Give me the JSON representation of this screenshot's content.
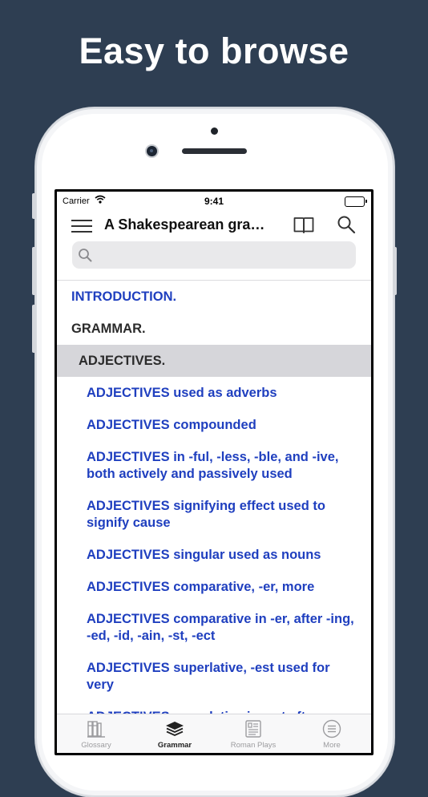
{
  "promo": {
    "headline": "Easy to browse"
  },
  "status_bar": {
    "carrier": "Carrier",
    "time": "9:41"
  },
  "navbar": {
    "title": "A Shakespearean gra…",
    "menu_icon": "hamburger-menu-icon",
    "book_icon": "open-book-icon",
    "search_icon": "search-icon"
  },
  "search": {
    "value": "",
    "placeholder": ""
  },
  "list": {
    "items": [
      {
        "label": "INTRODUCTION.",
        "level": "top-link"
      },
      {
        "label": "GRAMMAR.",
        "level": "top"
      },
      {
        "label": "ADJECTIVES.",
        "level": "selected"
      },
      {
        "label": "ADJECTIVES used as adverbs",
        "level": "sub"
      },
      {
        "label": "ADJECTIVES compounded",
        "level": "sub"
      },
      {
        "label": "ADJECTIVES in -ful, -less, -ble, and -ive, both actively and passively used",
        "level": "sub"
      },
      {
        "label": "ADJECTIVES signifying effect used to signify cause",
        "level": "sub"
      },
      {
        "label": "ADJECTIVES singular used as nouns",
        "level": "sub"
      },
      {
        "label": "ADJECTIVES comparative, -er, more",
        "level": "sub"
      },
      {
        "label": "ADJECTIVES comparative in -er, after -ing, -ed, -id, -ain, -st, -ect",
        "level": "sub"
      },
      {
        "label": "ADJECTIVES superlative, -est used for very",
        "level": "sub"
      },
      {
        "label": "ADJECTIVES superlative in -est after",
        "level": "sub"
      }
    ]
  },
  "tabbar": {
    "tabs": [
      {
        "label": "Glossary",
        "icon": "bookshelf-icon",
        "active": false
      },
      {
        "label": "Grammar",
        "icon": "stacked-layers-icon",
        "active": true
      },
      {
        "label": "Roman Plays",
        "icon": "scroll-icon",
        "active": false
      },
      {
        "label": "More",
        "icon": "more-circle-icon",
        "active": false
      }
    ]
  },
  "colors": {
    "background": "#2e3e52",
    "link_blue": "#1f3fbf",
    "selected_row": "#d6d6da",
    "tab_inactive": "#9c9c9f"
  }
}
